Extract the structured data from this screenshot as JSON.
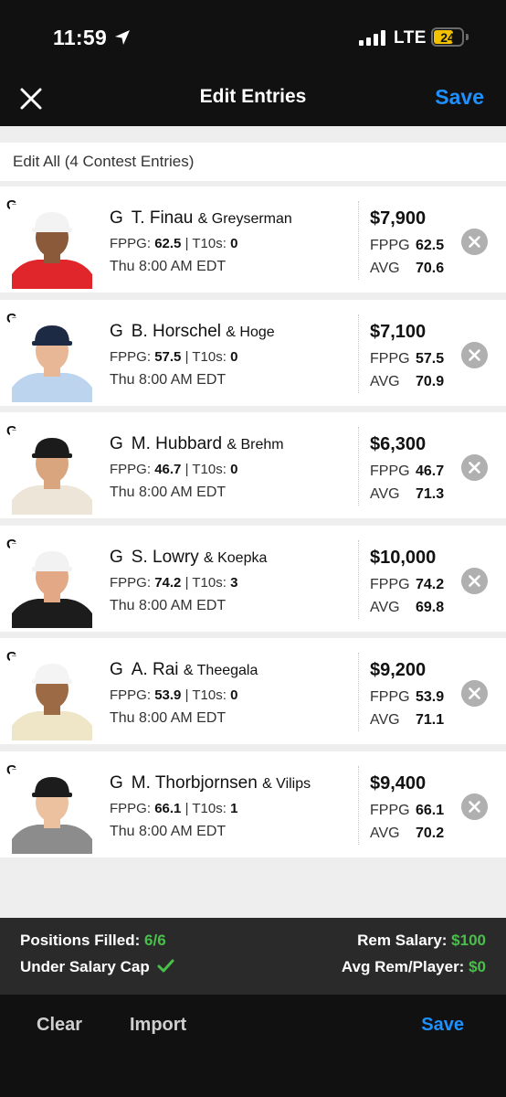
{
  "status_bar": {
    "time": "11:59",
    "network": "LTE",
    "battery": "24"
  },
  "header": {
    "title": "Edit Entries",
    "save_label": "Save"
  },
  "edit_all": {
    "label": "Edit All (4 Contest Entries)"
  },
  "labels": {
    "fppg_stat": "FPPG:",
    "t10_stat": "T10s:",
    "fppg_right": "FPPG",
    "avg_right": "AVG",
    "separator": "|"
  },
  "entries": [
    {
      "position": "G",
      "name": "T. Finau",
      "opponent": "& Greyserman",
      "fppg": "62.5",
      "t10s": "0",
      "time": "Thu 8:00 AM EDT",
      "salary": "$7,900",
      "fppg_right": "62.5",
      "avg": "70.6",
      "shirt": "#e0262b",
      "hat": "#f3f3f3",
      "skin": "#8a5a3a"
    },
    {
      "position": "G",
      "name": "B. Horschel",
      "opponent": "& Hoge",
      "fppg": "57.5",
      "t10s": "0",
      "time": "Thu 8:00 AM EDT",
      "salary": "$7,100",
      "fppg_right": "57.5",
      "avg": "70.9",
      "shirt": "#bcd4ee",
      "hat": "#1d2a44",
      "skin": "#e8b896"
    },
    {
      "position": "G",
      "name": "M. Hubbard",
      "opponent": "& Brehm",
      "fppg": "46.7",
      "t10s": "0",
      "time": "Thu 8:00 AM EDT",
      "salary": "$6,300",
      "fppg_right": "46.7",
      "avg": "71.3",
      "shirt": "#ece5d8",
      "hat": "#1b1b1b",
      "skin": "#d9a57e"
    },
    {
      "position": "G",
      "name": "S. Lowry",
      "opponent": "& Koepka",
      "fppg": "74.2",
      "t10s": "3",
      "time": "Thu 8:00 AM EDT",
      "salary": "$10,000",
      "fppg_right": "74.2",
      "avg": "69.8",
      "shirt": "#1c1c1c",
      "hat": "#f2f2f2",
      "skin": "#e3a987"
    },
    {
      "position": "G",
      "name": "A. Rai",
      "opponent": "& Theegala",
      "fppg": "53.9",
      "t10s": "0",
      "time": "Thu 8:00 AM EDT",
      "salary": "$9,200",
      "fppg_right": "53.9",
      "avg": "71.1",
      "shirt": "#efe6c8",
      "hat": "#f4f4f4",
      "skin": "#9c6a45"
    },
    {
      "position": "G",
      "name": "M. Thorbjornsen",
      "opponent": "& Vilips",
      "fppg": "66.1",
      "t10s": "1",
      "time": "Thu 8:00 AM EDT",
      "salary": "$9,400",
      "fppg_right": "66.1",
      "avg": "70.2",
      "shirt": "#8c8c8c",
      "hat": "#1c1c1c",
      "skin": "#ecc1a0"
    }
  ],
  "summary": {
    "positions_label": "Positions Filled:",
    "positions_value": "6/6",
    "cap_label": "Under Salary Cap",
    "rem_label": "Rem Salary:",
    "rem_value": "$100",
    "avg_rem_label": "Avg Rem/Player:",
    "avg_rem_value": "$0"
  },
  "bottom_bar": {
    "clear_label": "Clear",
    "import_label": "Import",
    "save_label": "Save"
  },
  "colors": {
    "accent": "#1e90ff",
    "success": "#49c04a"
  }
}
